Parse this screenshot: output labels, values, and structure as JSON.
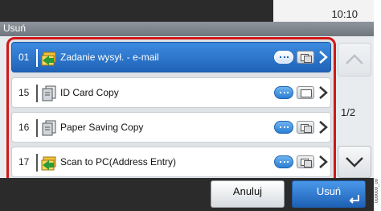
{
  "header": {
    "clock": "10:10",
    "title": "Usuń"
  },
  "list": {
    "items": [
      {
        "num": "01",
        "label": "Zadanie wysył. - e-mail",
        "icon": "send-to-email-icon",
        "selected": true
      },
      {
        "num": "15",
        "label": "ID Card Copy",
        "icon": "copy-icon",
        "selected": false
      },
      {
        "num": "16",
        "label": "Paper Saving Copy",
        "icon": "copy-icon",
        "selected": false
      },
      {
        "num": "17",
        "label": "Scan to PC(Address Entry)",
        "icon": "scan-to-pc-icon",
        "selected": false
      }
    ],
    "page_indicator": "1/2"
  },
  "footer": {
    "cancel_label": "Anuluj",
    "confirm_label": "Usuń"
  },
  "side_text": "000000_00",
  "colors": {
    "selected_row": "#2f78d0",
    "highlight_frame": "#d01818",
    "dark_bar": "#2b2b2b"
  }
}
